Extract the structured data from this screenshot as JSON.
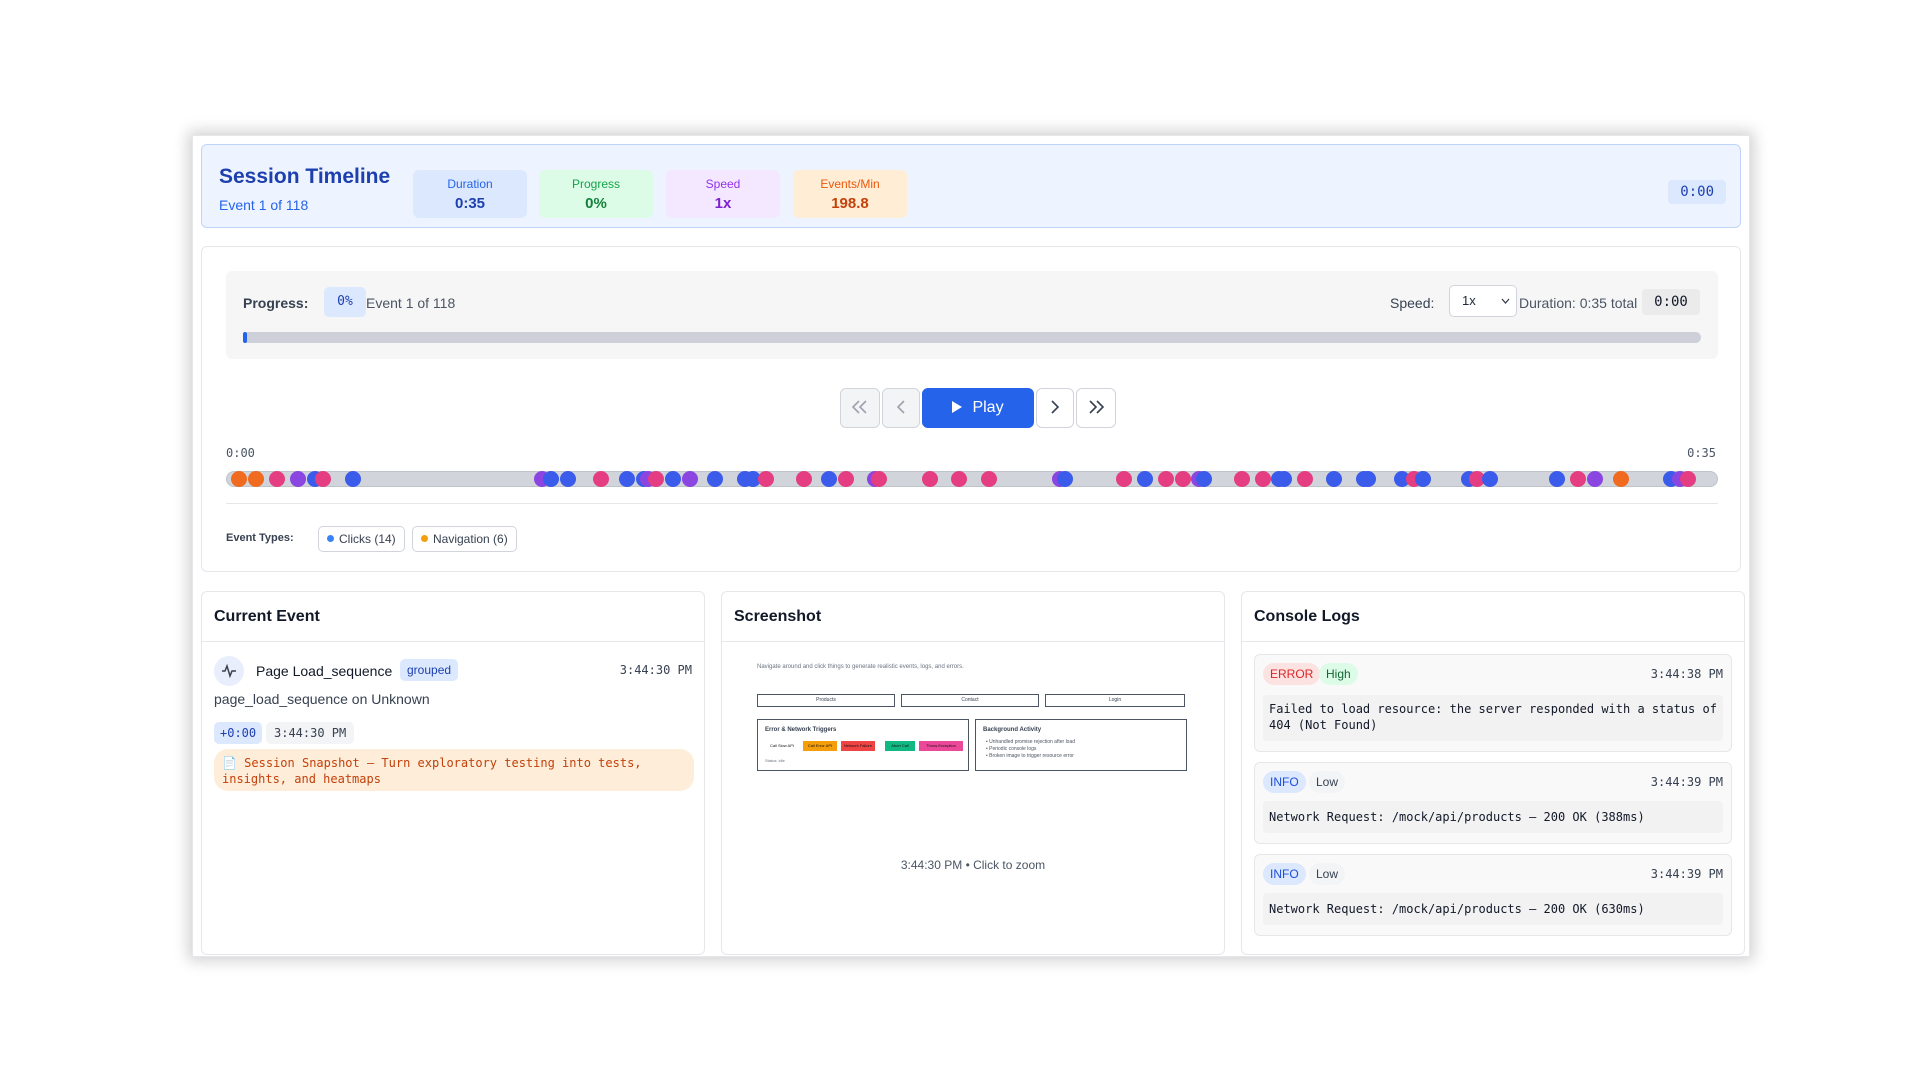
{
  "header": {
    "title": "Session Timeline",
    "subtitle": "Event 1 of 118",
    "clock": "0:00",
    "stats": {
      "duration": {
        "label": "Duration",
        "value": "0:35"
      },
      "progress": {
        "label": "Progress",
        "value": "0%"
      },
      "speed": {
        "label": "Speed",
        "value": "1x"
      },
      "events_per_min": {
        "label": "Events/Min",
        "value": "198.8"
      }
    }
  },
  "player": {
    "progress_label": "Progress:",
    "progress_pct": "0%",
    "progress_fraction": 0.0,
    "event_text": "Event 1 of 118",
    "speed_label": "Speed:",
    "speed_value": "1x",
    "duration_text": "Duration: 0:35 total",
    "clock": "0:00",
    "play_label": "Play",
    "icons": {
      "first": "double-chevron-left-icon",
      "prev": "chevron-left-icon",
      "play": "play-icon",
      "next": "chevron-right-icon",
      "last": "double-chevron-right-icon"
    }
  },
  "timeline": {
    "start": "0:00",
    "end": "0:35",
    "colors": {
      "click": "#3b5bea",
      "nav": "#e43d82",
      "form": "#8b45e0",
      "orange": "#f06a1f"
    },
    "events": [
      {
        "t": 0.1,
        "type": "orange"
      },
      {
        "t": 0.5,
        "type": "orange"
      },
      {
        "t": 1.0,
        "type": "nav"
      },
      {
        "t": 1.5,
        "type": "form"
      },
      {
        "t": 1.9,
        "type": "click"
      },
      {
        "t": 2.1,
        "type": "nav"
      },
      {
        "t": 2.8,
        "type": "click"
      },
      {
        "t": 7.3,
        "type": "form"
      },
      {
        "t": 7.5,
        "type": "click"
      },
      {
        "t": 7.9,
        "type": "click"
      },
      {
        "t": 8.7,
        "type": "nav"
      },
      {
        "t": 9.3,
        "type": "click"
      },
      {
        "t": 9.7,
        "type": "click"
      },
      {
        "t": 9.8,
        "type": "form"
      },
      {
        "t": 10.0,
        "type": "nav"
      },
      {
        "t": 10.4,
        "type": "click"
      },
      {
        "t": 10.8,
        "type": "form"
      },
      {
        "t": 11.4,
        "type": "click"
      },
      {
        "t": 12.1,
        "type": "click"
      },
      {
        "t": 12.3,
        "type": "click"
      },
      {
        "t": 12.6,
        "type": "nav"
      },
      {
        "t": 13.5,
        "type": "nav"
      },
      {
        "t": 14.1,
        "type": "click"
      },
      {
        "t": 14.5,
        "type": "nav"
      },
      {
        "t": 15.2,
        "type": "form"
      },
      {
        "t": 15.3,
        "type": "nav"
      },
      {
        "t": 16.5,
        "type": "nav"
      },
      {
        "t": 17.2,
        "type": "nav"
      },
      {
        "t": 17.9,
        "type": "nav"
      },
      {
        "t": 19.6,
        "type": "form"
      },
      {
        "t": 19.7,
        "type": "click"
      },
      {
        "t": 21.1,
        "type": "nav"
      },
      {
        "t": 21.6,
        "type": "click"
      },
      {
        "t": 22.1,
        "type": "nav"
      },
      {
        "t": 22.5,
        "type": "nav"
      },
      {
        "t": 22.9,
        "type": "form"
      },
      {
        "t": 23.0,
        "type": "click"
      },
      {
        "t": 23.9,
        "type": "nav"
      },
      {
        "t": 24.4,
        "type": "nav"
      },
      {
        "t": 24.8,
        "type": "click"
      },
      {
        "t": 24.9,
        "type": "click"
      },
      {
        "t": 25.4,
        "type": "nav"
      },
      {
        "t": 26.1,
        "type": "click"
      },
      {
        "t": 26.8,
        "type": "click"
      },
      {
        "t": 26.9,
        "type": "click"
      },
      {
        "t": 27.7,
        "type": "click"
      },
      {
        "t": 28.0,
        "type": "nav"
      },
      {
        "t": 28.2,
        "type": "click"
      },
      {
        "t": 29.3,
        "type": "click"
      },
      {
        "t": 29.5,
        "type": "nav"
      },
      {
        "t": 29.8,
        "type": "click"
      },
      {
        "t": 31.4,
        "type": "click"
      },
      {
        "t": 31.9,
        "type": "nav"
      },
      {
        "t": 32.3,
        "type": "form"
      },
      {
        "t": 32.9,
        "type": "orange"
      },
      {
        "t": 34.1,
        "type": "click"
      },
      {
        "t": 34.3,
        "type": "form"
      },
      {
        "t": 34.5,
        "type": "nav"
      }
    ],
    "legend_label": "Event Types:",
    "legend": [
      {
        "label": "Clicks (14)",
        "color": "#3b82f6"
      },
      {
        "label": "Navigation (6)",
        "color": "#f59e0b"
      }
    ]
  },
  "current_event": {
    "heading": "Current Event",
    "icon": "activity-icon",
    "name": "Page Load_sequence",
    "tag": "grouped",
    "time": "3:44:30 PM",
    "description": "page_load_sequence on Unknown",
    "offset": "+0:00",
    "clock": "3:44:30 PM",
    "note": "📄 Session Snapshot – Turn exploratory testing into tests, insights, and heatmaps"
  },
  "screenshot": {
    "heading": "Screenshot",
    "caption": "3:44:30 PM • Click to zoom",
    "preview": {
      "intro": "Navigate around and click things to generate realistic events, logs, and errors.",
      "nav": [
        "Products",
        "Contact",
        "Login"
      ],
      "box1_title": "Error & Network Triggers",
      "box1_buttons": [
        {
          "label": "Call Slow API",
          "color": "#ffffff"
        },
        {
          "label": "Call Error API",
          "color": "#f59e0b"
        },
        {
          "label": "Network Failure",
          "color": "#ef4444"
        },
        {
          "label": "Abort Call",
          "color": "#10b981"
        },
        {
          "label": "Throw Exception",
          "color": "#ec4899"
        }
      ],
      "box1_status": "Status: idle",
      "box2_title": "Background Activity",
      "box2_items": [
        "• Unhandled promise rejection after load",
        "• Periodic console logs",
        "• Broken image to trigger resource error"
      ]
    }
  },
  "console": {
    "heading": "Console Logs",
    "logs": [
      {
        "level": "ERROR",
        "severity": "High",
        "time": "3:44:38 PM",
        "message": "Failed to load resource: the server responded with a status of 404 (Not Found)"
      },
      {
        "level": "INFO",
        "severity": "Low",
        "time": "3:44:39 PM",
        "message": "Network Request: /mock/api/products – 200 OK (388ms)"
      },
      {
        "level": "INFO",
        "severity": "Low",
        "time": "3:44:39 PM",
        "message": "Network Request: /mock/api/products – 200 OK (630ms)"
      }
    ]
  }
}
